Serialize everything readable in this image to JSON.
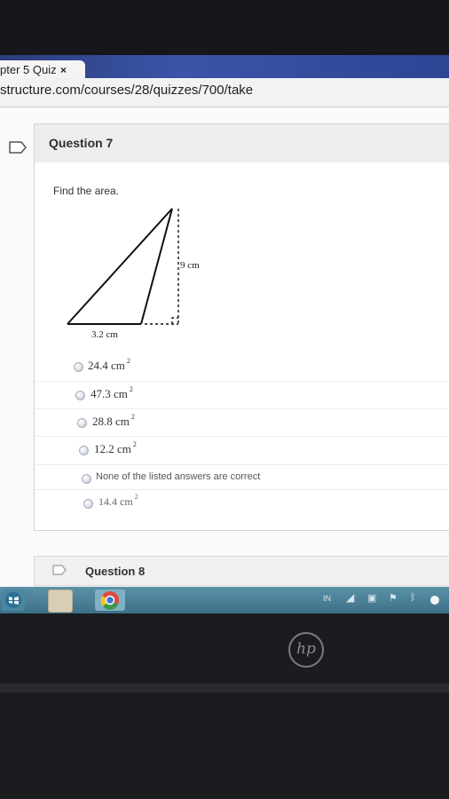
{
  "browser": {
    "tab_title": "pter 5 Quiz",
    "tab_close": "×",
    "url": "structure.com/courses/28/quizzes/700/take"
  },
  "question7": {
    "title": "Question 7",
    "prompt": "Find the area.",
    "figure": {
      "base_label": "3.2 cm",
      "height_label": "9 cm"
    },
    "answers": [
      {
        "value": "24.4 cm",
        "sup": "2"
      },
      {
        "value": "47.3 cm",
        "sup": "2"
      },
      {
        "value": "28.8 cm",
        "sup": "2"
      },
      {
        "value": "12.2 cm",
        "sup": "2"
      },
      {
        "value": "None of the listed answers are correct",
        "sup": ""
      },
      {
        "value": "14.4 cm",
        "sup": "2"
      }
    ]
  },
  "question8": {
    "title": "Question 8"
  },
  "taskbar": {
    "lang": "IN"
  },
  "laptop": {
    "logo": "hp"
  }
}
